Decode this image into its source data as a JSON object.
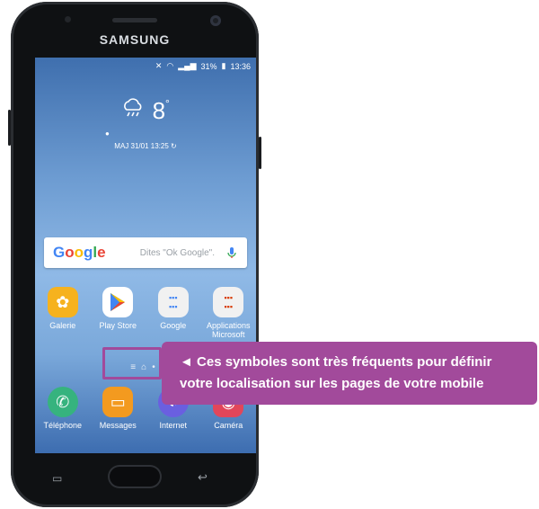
{
  "phone": {
    "brand": "SAMSUNG",
    "status_bar": {
      "icons": [
        "mute-icon",
        "wifi-icon",
        "signal-icon"
      ],
      "battery": "31%",
      "time": "13:36"
    },
    "weather": {
      "icon": "cloud-rain-icon",
      "temperature": "8",
      "degree_symbol": "°",
      "update_text": "MAJ 31/01 13:25"
    },
    "google_search": {
      "logo": "Google",
      "placeholder": "Dites \"Ok Google\"."
    },
    "apps": [
      {
        "label": "Galerie",
        "icon": "gallery-icon",
        "color": "#f6b21e"
      },
      {
        "label": "Play Store",
        "icon": "play-store-icon",
        "color": "#ffffff"
      },
      {
        "label": "Google",
        "icon": "google-folder-icon",
        "color": "#ffffff"
      },
      {
        "label": "Applications\nMicrosoft",
        "icon": "microsoft-folder-icon",
        "color": "#ffffff"
      }
    ],
    "dock": [
      {
        "label": "Téléphone",
        "icon": "phone-icon",
        "color": "#36b37e"
      },
      {
        "label": "Messages",
        "icon": "messages-icon",
        "color": "#f39a1f"
      },
      {
        "label": "Internet",
        "icon": "internet-icon",
        "color": "#6a5fe0"
      },
      {
        "label": "Caméra",
        "icon": "camera-icon",
        "color": "#e2465a"
      }
    ]
  },
  "annotation": {
    "arrow": "◄",
    "line1": "Ces symboles sont très fréquents pour définir",
    "line2": "votre localisation sur les pages de votre mobile",
    "color": "#a24a9b"
  }
}
